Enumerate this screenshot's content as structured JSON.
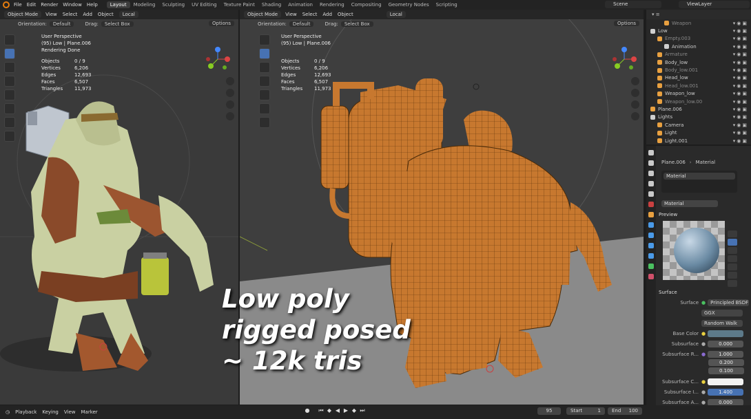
{
  "topbar": {
    "menu": [
      "File",
      "Edit",
      "Render",
      "Window",
      "Help"
    ],
    "workspaces": [
      "Layout",
      "Modeling",
      "Sculpting",
      "UV Editing",
      "Texture Paint",
      "Shading",
      "Animation",
      "Rendering",
      "Compositing",
      "Geometry Nodes",
      "Scripting"
    ],
    "active_workspace": "Layout",
    "scene": "Scene",
    "view_layer": "ViewLayer"
  },
  "viewport_header": {
    "mode": "Object Mode",
    "menus": [
      "View",
      "Select",
      "Add",
      "Object"
    ],
    "transform": "Local",
    "orientation_label": "Orientation:",
    "orientation": "Default",
    "drag_label": "Drag:",
    "drag": "Select Box",
    "options": "Options"
  },
  "left_viewport": {
    "perspective": "User Perspective",
    "object": "(95) Low | Plane.006",
    "status": "Rendering Done"
  },
  "right_viewport": {
    "perspective": "User Perspective",
    "object": "(95) Low | Plane.006"
  },
  "stats": [
    {
      "label": "Objects",
      "value": "0 / 9"
    },
    {
      "label": "Vertices",
      "value": "6,206"
    },
    {
      "label": "Edges",
      "value": "12,693"
    },
    {
      "label": "Faces",
      "value": "6,507"
    },
    {
      "label": "Triangles",
      "value": "11,973"
    }
  ],
  "caption": [
    "Low poly",
    "rigged posed",
    "~ 12k tris"
  ],
  "outliner": {
    "items": [
      {
        "name": "Weapon",
        "indent": 2,
        "color": "#e8a040",
        "dim": true
      },
      {
        "name": "Low",
        "indent": 0,
        "color": "#cfcfcf",
        "dim": false
      },
      {
        "name": "Empty.003",
        "indent": 1,
        "color": "#e8a040",
        "dim": true
      },
      {
        "name": "Animation",
        "indent": 2,
        "color": "#cfcfcf",
        "dim": false
      },
      {
        "name": "Armature",
        "indent": 1,
        "color": "#e8a040",
        "dim": true
      },
      {
        "name": "Body_low",
        "indent": 1,
        "color": "#e8a040",
        "dim": false
      },
      {
        "name": "Body_low.001",
        "indent": 1,
        "color": "#e8a040",
        "dim": true
      },
      {
        "name": "Head_low",
        "indent": 1,
        "color": "#e8a040",
        "dim": false
      },
      {
        "name": "Head_low.001",
        "indent": 1,
        "color": "#e8a040",
        "dim": true
      },
      {
        "name": "Weapon_low",
        "indent": 1,
        "color": "#e8a040",
        "dim": false
      },
      {
        "name": "Weapon_low.00",
        "indent": 1,
        "color": "#e8a040",
        "dim": true
      },
      {
        "name": "Plane.006",
        "indent": 0,
        "color": "#e8a040",
        "dim": false
      },
      {
        "name": "Lights",
        "indent": 0,
        "color": "#cfcfcf",
        "dim": false
      },
      {
        "name": "Camera",
        "indent": 1,
        "color": "#e8a040",
        "dim": false
      },
      {
        "name": "Light",
        "indent": 1,
        "color": "#e8a040",
        "dim": false
      },
      {
        "name": "Light.001",
        "indent": 1,
        "color": "#e8a040",
        "dim": false
      }
    ]
  },
  "properties": {
    "breadcrumb_object": "Plane.006",
    "breadcrumb_material": "Material",
    "slot": "Material",
    "material_name": "Material",
    "preview_label": "Preview",
    "surface_section": "Surface",
    "surface_label": "Surface",
    "surface_value": "Principled BSDF",
    "distribution": "GGX",
    "subsurface_method": "Random Walk",
    "base_color_label": "Base Color",
    "base_color": "#5d7a8a",
    "subsurface_label": "Subsurface",
    "subsurface_value": "0.000",
    "subsurface_radius_label": "Subsurface R...",
    "radius": [
      "1.000",
      "0.200",
      "0.100"
    ],
    "subsurface_color_label": "Subsurface C...",
    "subsurface_ior_label": "Subsurface I...",
    "subsurface_ior": "1.400",
    "subsurface_aniso_label": "Subsurface A...",
    "subsurface_aniso": "0.000"
  },
  "timeline": {
    "menus": [
      "Playback",
      "Keying",
      "View",
      "Marker"
    ],
    "current_frame": "95",
    "start_label": "Start",
    "start": "1",
    "end_label": "End",
    "end": "100"
  }
}
